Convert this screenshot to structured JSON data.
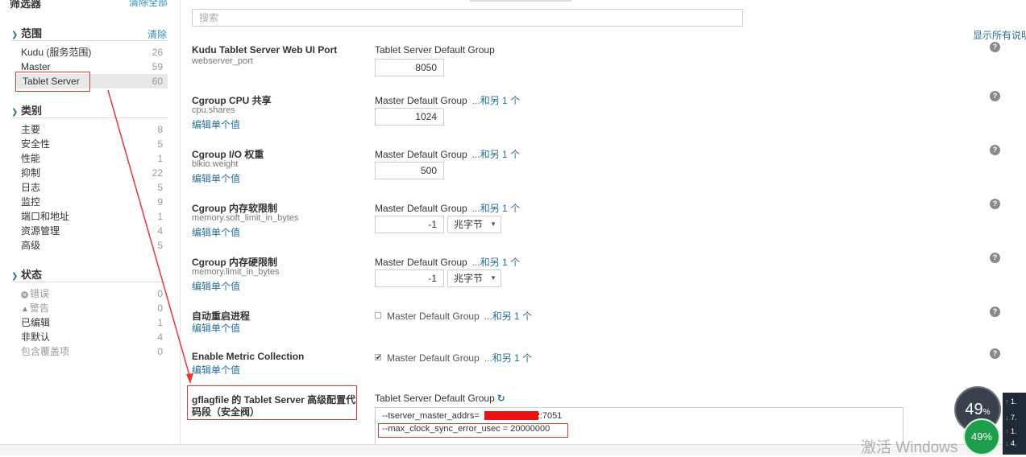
{
  "sidebar": {
    "filter_title": "筛选器",
    "clear_all": "清除全部",
    "scope": {
      "title": "范围",
      "clear": "清除",
      "items": [
        {
          "label": "Kudu (服务范围)",
          "count": "26"
        },
        {
          "label": "Master",
          "count": "59"
        },
        {
          "label": "Tablet Server",
          "count": "60"
        }
      ]
    },
    "category": {
      "title": "类别",
      "items": [
        {
          "label": "主要",
          "count": "8"
        },
        {
          "label": "安全性",
          "count": "5"
        },
        {
          "label": "性能",
          "count": "1"
        },
        {
          "label": "抑制",
          "count": "22"
        },
        {
          "label": "日志",
          "count": "5"
        },
        {
          "label": "监控",
          "count": "9"
        },
        {
          "label": "端口和地址",
          "count": "1"
        },
        {
          "label": "资源管理",
          "count": "4"
        },
        {
          "label": "高级",
          "count": "5"
        }
      ]
    },
    "status": {
      "title": "状态",
      "items": [
        {
          "label": "错误",
          "count": "0"
        },
        {
          "label": "警告",
          "count": "0"
        },
        {
          "label": "已编辑",
          "count": "1"
        },
        {
          "label": "非默认",
          "count": "4"
        },
        {
          "label": "包含覆盖项",
          "count": "0"
        }
      ]
    }
  },
  "search": {
    "placeholder": "搜索"
  },
  "show_all_desc": "显示所有说明",
  "common": {
    "edit_single": "编辑单个值",
    "and_one_more": "...和另 1 个"
  },
  "props": [
    {
      "title": "Kudu Tablet Server Web UI Port",
      "key": "webserver_port",
      "group": "Tablet Server Default Group",
      "value": "8050"
    },
    {
      "title": "Cgroup CPU 共享",
      "key": "cpu.shares",
      "group": "Master Default Group",
      "value": "1024"
    },
    {
      "title": "Cgroup I/O 权重",
      "key": "blkio.weight",
      "group": "Master Default Group",
      "value": "500"
    },
    {
      "title": "Cgroup 内存软限制",
      "key": "memory.soft_limit_in_bytes",
      "group": "Master Default Group",
      "value": "-1",
      "unit": "兆字节"
    },
    {
      "title": "Cgroup 内存硬限制",
      "key": "memory.limit_in_bytes",
      "group": "Master Default Group",
      "value": "-1",
      "unit": "兆字节"
    },
    {
      "title": "自动重启进程",
      "group": "Master Default Group",
      "checked": false
    },
    {
      "title": "Enable Metric Collection",
      "group": "Master Default Group",
      "checked": true
    },
    {
      "title_line1": "gflagfile 的 Tablet Server 高级配置代",
      "title_line2": "码段（安全阀）",
      "group": "Tablet Server Default Group",
      "line1_prefix": "--tserver_master_addrs=",
      "line1_suffix": "2:7051",
      "line2": "--max_clock_sync_error_usec = 20000000"
    }
  ],
  "widgets": {
    "gauge_large": "49",
    "gauge_large_unit": "%",
    "gauge_small": "49%",
    "panel": [
      "1.",
      "7.",
      "1.",
      "4."
    ]
  },
  "watermark": "激活 Windows",
  "colors": {
    "accent": "#2a6f9a",
    "annotation": "#e53935",
    "gauge_green": "#1e9e4a"
  }
}
